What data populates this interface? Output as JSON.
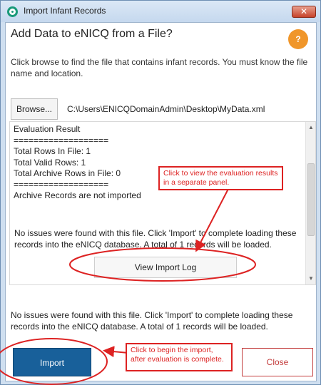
{
  "window": {
    "title": "Import Infant Records",
    "close_glyph": "✕",
    "app_icon": "enicq-logo-icon"
  },
  "dialog": {
    "heading": "Add Data to eNICQ from a File?",
    "help_label": "?",
    "instructions": "Click browse to find the file that contains infant records.  You must know the file name and location.",
    "browse_label": "Browse...",
    "file_path": "C:\\Users\\ENICQDomainAdmin\\Desktop\\MyData.xml"
  },
  "evaluation": {
    "lines": [
      "Evaluation Result",
      "===================",
      "Total Rows In File: 1",
      "Total Valid Rows: 1",
      "Total Archive Rows in File: 0",
      "===================",
      "Archive Records are not imported"
    ],
    "message": "No issues were found with this file. Click 'Import' to complete loading these records into the eNICQ database. A total of 1 records will be loaded.",
    "view_log_label": "View Import Log"
  },
  "footer": {
    "message": "No issues were found with this file. Click 'Import' to complete loading these records into the eNICQ database. A total of 1 records will be loaded.",
    "import_label": "Import",
    "close_label": "Close"
  },
  "annotations": {
    "view_log_callout": "Click to view the evaluation results in a separate panel.",
    "import_callout": "Click to begin the import, after evaluation is complete.",
    "color": "#dd2222"
  },
  "colors": {
    "import_button": "#18609a",
    "close_button_border": "#c33d3d",
    "help_button": "#f0962a"
  }
}
